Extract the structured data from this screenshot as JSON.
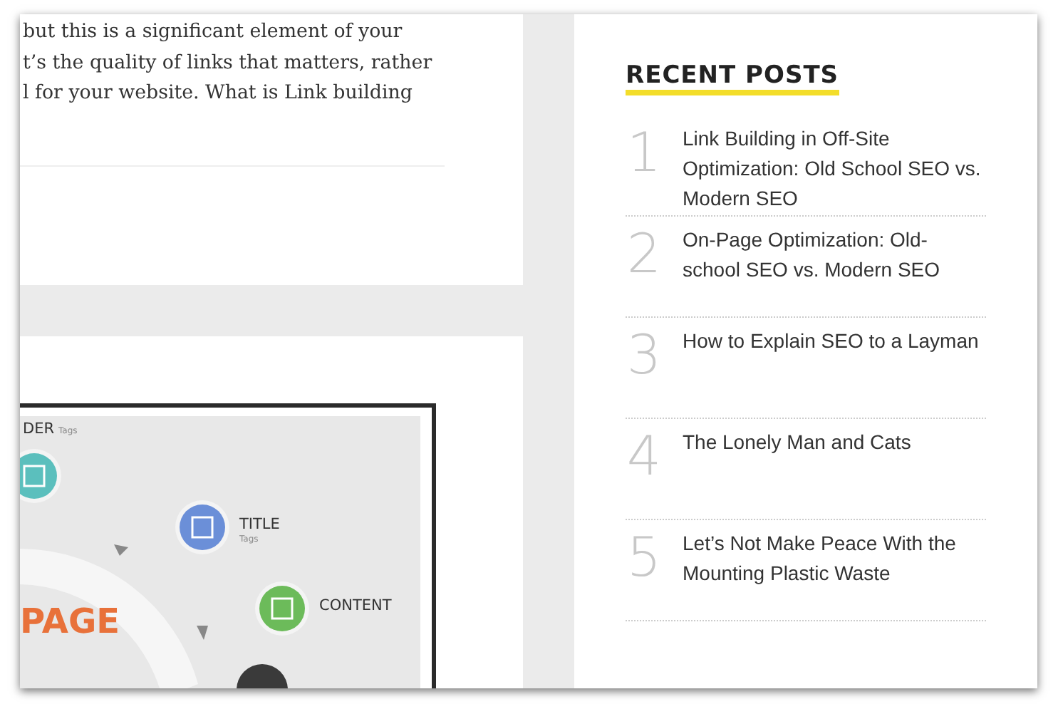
{
  "article_excerpt": {
    "lines": [
      "but this is a significant element of your",
      "t’s the quality of links that matters, rather",
      "l for your website. What is Link building"
    ]
  },
  "infographic": {
    "labels": [
      {
        "kind": "header",
        "title": "DER",
        "sub": "Tags"
      },
      {
        "kind": "title",
        "title": "TITLE",
        "sub": "Tags"
      },
      {
        "kind": "content",
        "title": "CONTENT"
      }
    ],
    "center_text": "PAGE"
  },
  "sidebar": {
    "heading": "RECENT POSTS",
    "posts": [
      {
        "number": "1",
        "title": "Link Building in Off-Site Optimization: Old School SEO vs. Modern SEO"
      },
      {
        "number": "2",
        "title": "On-Page Optimization: Old-school SEO vs. Modern SEO"
      },
      {
        "number": "3",
        "title": "How to Explain SEO to a Layman"
      },
      {
        "number": "4",
        "title": "The Lonely Man and Cats"
      },
      {
        "number": "5",
        "title": "Let’s Not Make Peace With the Mounting Plastic Waste"
      }
    ]
  }
}
